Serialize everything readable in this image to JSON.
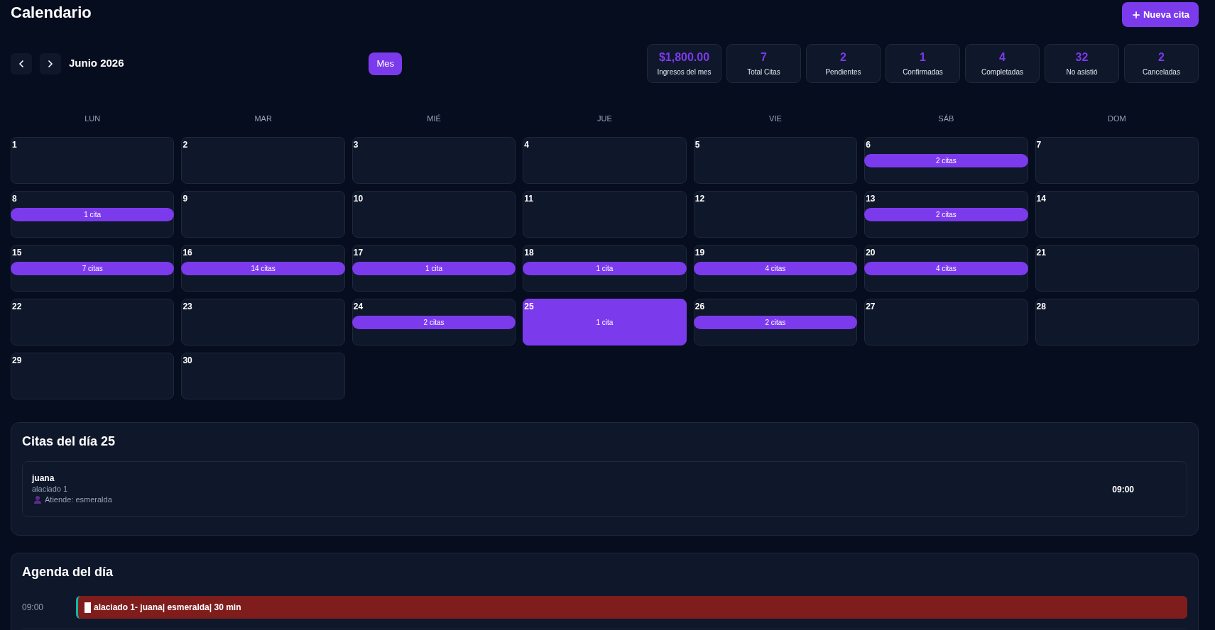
{
  "header": {
    "title": "Calendario",
    "new_button": "Nueva cita"
  },
  "toolbar": {
    "month": "Junio 2026",
    "views": [
      {
        "label": "Mes",
        "selected": true
      }
    ]
  },
  "stats": [
    {
      "value": "$1,800.00",
      "label": "Ingresos del mes"
    },
    {
      "value": "7",
      "label": "Total Citas"
    },
    {
      "value": "2",
      "label": "Pendientes"
    },
    {
      "value": "1",
      "label": "Confirmadas"
    },
    {
      "value": "4",
      "label": "Completadas"
    },
    {
      "value": "32",
      "label": "No asistió"
    },
    {
      "value": "2",
      "label": "Canceladas"
    }
  ],
  "calendar": {
    "weekdays": [
      "LUN",
      "MAR",
      "MIÉ",
      "JUE",
      "VIE",
      "SÁB",
      "DOM"
    ],
    "days": [
      {
        "day": "1",
        "selected": false
      },
      {
        "day": "2",
        "selected": false
      },
      {
        "day": "3",
        "selected": false
      },
      {
        "day": "4",
        "selected": false
      },
      {
        "day": "5",
        "selected": false
      },
      {
        "day": "6",
        "appointments": "2 citas",
        "selected": false
      },
      {
        "day": "7",
        "selected": false
      },
      {
        "day": "8",
        "appointments": "1 cita",
        "selected": false
      },
      {
        "day": "9",
        "selected": false
      },
      {
        "day": "10",
        "selected": false
      },
      {
        "day": "11",
        "selected": false
      },
      {
        "day": "12",
        "selected": false
      },
      {
        "day": "13",
        "appointments": "2 citas",
        "selected": false
      },
      {
        "day": "14",
        "selected": false
      },
      {
        "day": "15",
        "appointments": "7 citas",
        "selected": false
      },
      {
        "day": "16",
        "appointments": "14 citas",
        "selected": false
      },
      {
        "day": "17",
        "appointments": "1 cita",
        "selected": false
      },
      {
        "day": "18",
        "appointments": "1 cita",
        "selected": false
      },
      {
        "day": "19",
        "appointments": "4 citas",
        "selected": false
      },
      {
        "day": "20",
        "appointments": "4 citas",
        "selected": false
      },
      {
        "day": "21",
        "selected": false
      },
      {
        "day": "22",
        "selected": false
      },
      {
        "day": "23",
        "selected": false
      },
      {
        "day": "24",
        "appointments": "2 citas",
        "selected": false
      },
      {
        "day": "25",
        "appointments": "1 cita",
        "selected": true
      },
      {
        "day": "26",
        "appointments": "2 citas",
        "selected": false
      },
      {
        "day": "27",
        "selected": false
      },
      {
        "day": "28",
        "selected": false
      },
      {
        "day": "29",
        "selected": false
      },
      {
        "day": "30",
        "selected": false
      }
    ]
  },
  "day_detail": {
    "title": "Citas del día 25",
    "appointments": [
      {
        "client": "juana",
        "service": "alaciado 1",
        "staff": "Atiende: esmeralda",
        "time": "09:00"
      }
    ]
  },
  "agenda": {
    "title": "Agenda del día",
    "slots": [
      {
        "time": "09:00",
        "events": [
          {
            "text": "alaciado 1- juana| esmeralda| 30 min",
            "color": "#7f1d1d"
          }
        ]
      }
    ]
  }
}
